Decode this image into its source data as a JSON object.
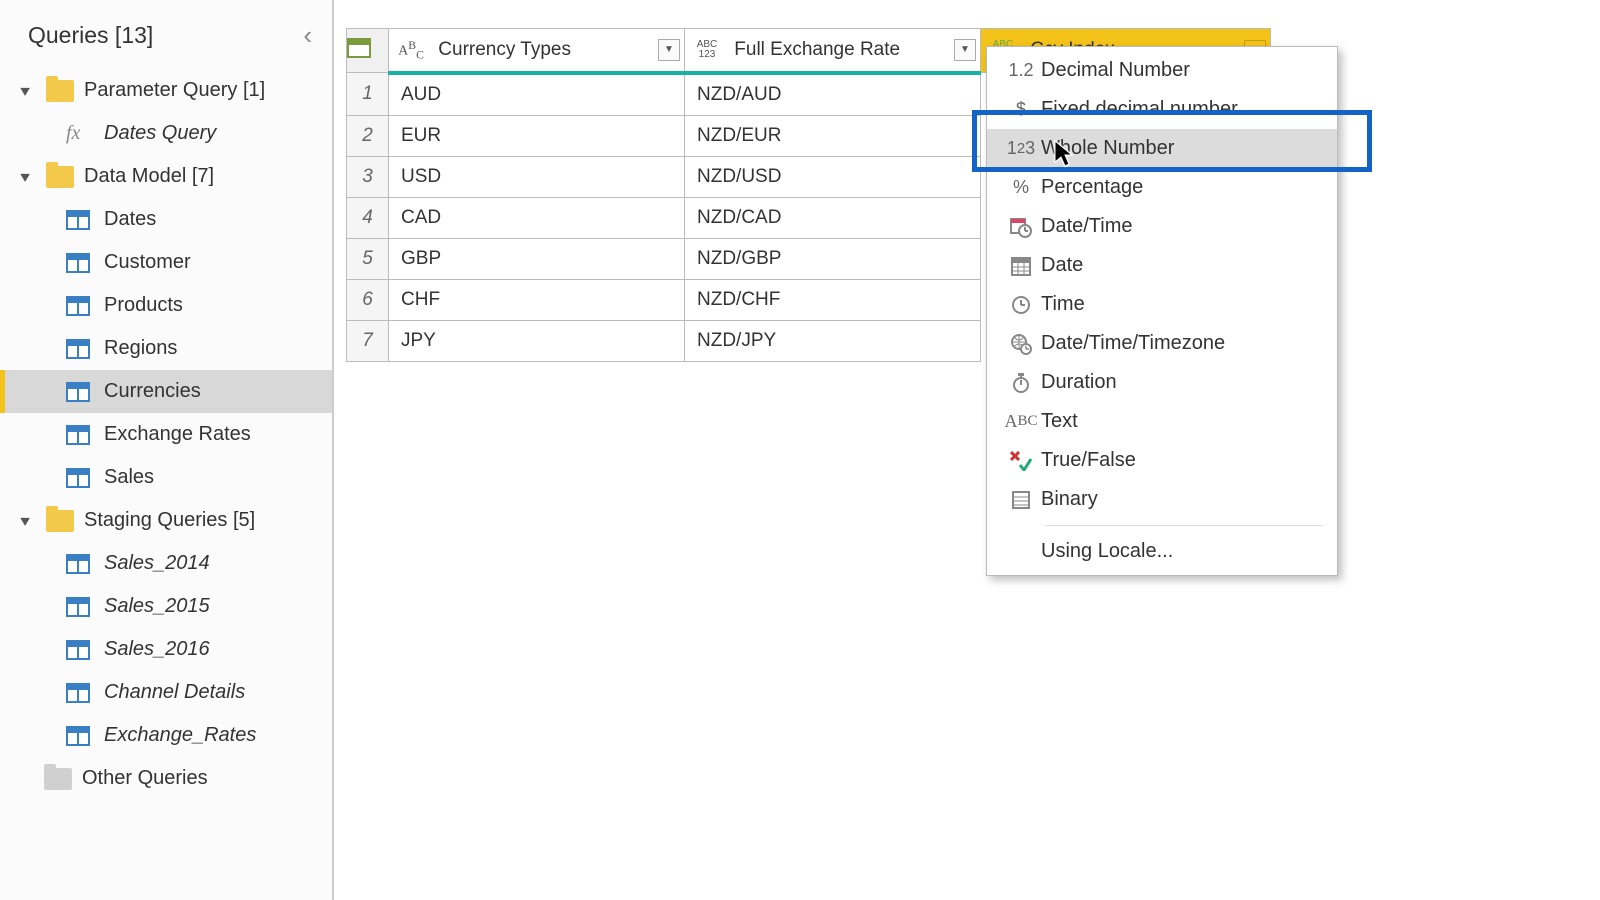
{
  "sidebar": {
    "title": "Queries [13]",
    "groups": [
      {
        "label": "Parameter Query [1]",
        "items": [
          {
            "label": "Dates Query",
            "icon": "fx",
            "italic": true
          }
        ]
      },
      {
        "label": "Data Model [7]",
        "items": [
          {
            "label": "Dates",
            "icon": "table"
          },
          {
            "label": "Customer",
            "icon": "table"
          },
          {
            "label": "Products",
            "icon": "table"
          },
          {
            "label": "Regions",
            "icon": "table"
          },
          {
            "label": "Currencies",
            "icon": "table",
            "selected": true
          },
          {
            "label": "Exchange Rates",
            "icon": "table"
          },
          {
            "label": "Sales",
            "icon": "table"
          }
        ]
      },
      {
        "label": "Staging Queries [5]",
        "items": [
          {
            "label": "Sales_2014",
            "icon": "table",
            "italic": true
          },
          {
            "label": "Sales_2015",
            "icon": "table",
            "italic": true
          },
          {
            "label": "Sales_2016",
            "icon": "table",
            "italic": true
          },
          {
            "label": "Channel Details",
            "icon": "table",
            "italic": true
          },
          {
            "label": "Exchange_Rates",
            "icon": "table",
            "italic": true
          }
        ]
      }
    ],
    "other": {
      "label": "Other Queries"
    }
  },
  "table": {
    "columns": [
      {
        "name": "Currency Types",
        "type_icon": "ABC"
      },
      {
        "name": "Full Exchange Rate",
        "type_icon": "ABC123"
      },
      {
        "name": "Ccy Index",
        "type_icon": "ABC123",
        "selected": true
      }
    ],
    "rows": [
      {
        "n": "1",
        "c1": "AUD",
        "c2": "NZD/AUD"
      },
      {
        "n": "2",
        "c1": "EUR",
        "c2": "NZD/EUR"
      },
      {
        "n": "3",
        "c1": "USD",
        "c2": "NZD/USD"
      },
      {
        "n": "4",
        "c1": "CAD",
        "c2": "NZD/CAD"
      },
      {
        "n": "5",
        "c1": "GBP",
        "c2": "NZD/GBP"
      },
      {
        "n": "6",
        "c1": "CHF",
        "c2": "NZD/CHF"
      },
      {
        "n": "7",
        "c1": "JPY",
        "c2": "NZD/JPY"
      }
    ]
  },
  "type_menu": {
    "items": [
      {
        "icon": "1.2",
        "label": "Decimal Number"
      },
      {
        "icon": "$",
        "label": "Fixed decimal number"
      },
      {
        "icon": "1²3",
        "label": "Whole Number",
        "hover": true
      },
      {
        "icon": "%",
        "label": "Percentage"
      },
      {
        "icon": "cal-clock",
        "label": "Date/Time"
      },
      {
        "icon": "cal",
        "label": "Date"
      },
      {
        "icon": "clock",
        "label": "Time"
      },
      {
        "icon": "globe",
        "label": "Date/Time/Timezone"
      },
      {
        "icon": "stopwatch",
        "label": "Duration"
      },
      {
        "icon": "ABC",
        "label": "Text"
      },
      {
        "icon": "xy",
        "label": "True/False"
      },
      {
        "icon": "binary",
        "label": "Binary"
      }
    ],
    "locale": "Using Locale..."
  }
}
